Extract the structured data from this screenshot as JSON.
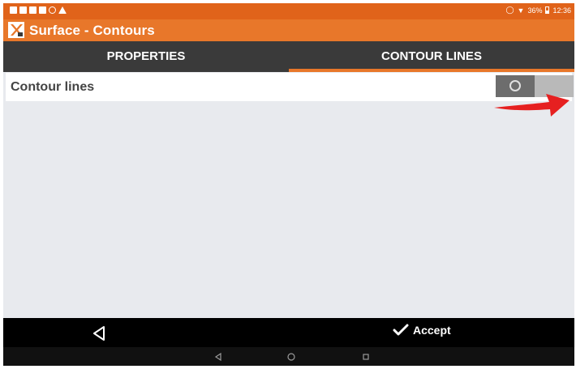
{
  "status_bar": {
    "icons": [
      "notification-icon",
      "gallery-icon",
      "gallery-icon",
      "folder-icon",
      "sync-icon",
      "warning-icon"
    ],
    "signal_icons": [
      "vibrate-icon",
      "wifi-icon"
    ],
    "battery_percent": "36%",
    "time": "12:36"
  },
  "app_bar": {
    "title": "Surface - Contours",
    "logo_icon": "app-logo-icon"
  },
  "tabs": [
    {
      "label": "PROPERTIES",
      "active": false
    },
    {
      "label": "CONTOUR LINES",
      "active": true
    }
  ],
  "content": {
    "contour_lines": {
      "label": "Contour lines",
      "enabled": false
    }
  },
  "annotation": {
    "arrow_color": "#e62020"
  },
  "bottom_bar": {
    "back_icon": "back-triangle-icon",
    "accept_label": "Accept",
    "accept_icon": "checkmark-icon"
  },
  "nav_bar": {
    "buttons": [
      "nav-back-icon",
      "nav-home-icon",
      "nav-recents-icon"
    ]
  },
  "colors": {
    "status_bar": "#e0631a",
    "app_bar": "#e8772a",
    "tabs_bg": "#3a3a3a",
    "tab_indicator": "#e8772a",
    "content_bg": "#e8eaee"
  }
}
